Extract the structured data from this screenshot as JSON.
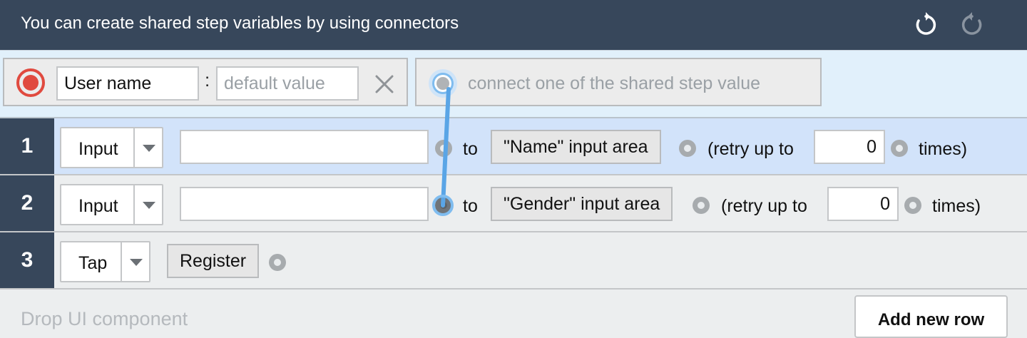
{
  "header": {
    "title": "You can create shared step variables by using connectors",
    "undo_icon": "undo-icon",
    "redo_icon": "redo-icon"
  },
  "variable": {
    "name": "User name",
    "separator": ":",
    "default_placeholder": "default value",
    "connect_placeholder": "connect one of the shared step value"
  },
  "steps": [
    {
      "number": "1",
      "action": "Input",
      "input_value": "",
      "to": "to",
      "target": "\"Name\" input area",
      "retry_prefix": "(retry up to",
      "retry_count": "0",
      "retry_suffix": "times)"
    },
    {
      "number": "2",
      "action": "Input",
      "input_value": "",
      "to": "to",
      "target": "\"Gender\" input area",
      "retry_prefix": "(retry up to",
      "retry_count": "0",
      "retry_suffix": "times)"
    },
    {
      "number": "3",
      "action": "Tap",
      "target": "Register"
    }
  ],
  "footer": {
    "drop_text": "Drop UI component",
    "add_row_label": "Add new row"
  },
  "colors": {
    "header_bg": "#37475b",
    "active_row_bg": "#d2e3fa",
    "connector": "#5aa5e6",
    "record_icon": "#e04a3f"
  }
}
